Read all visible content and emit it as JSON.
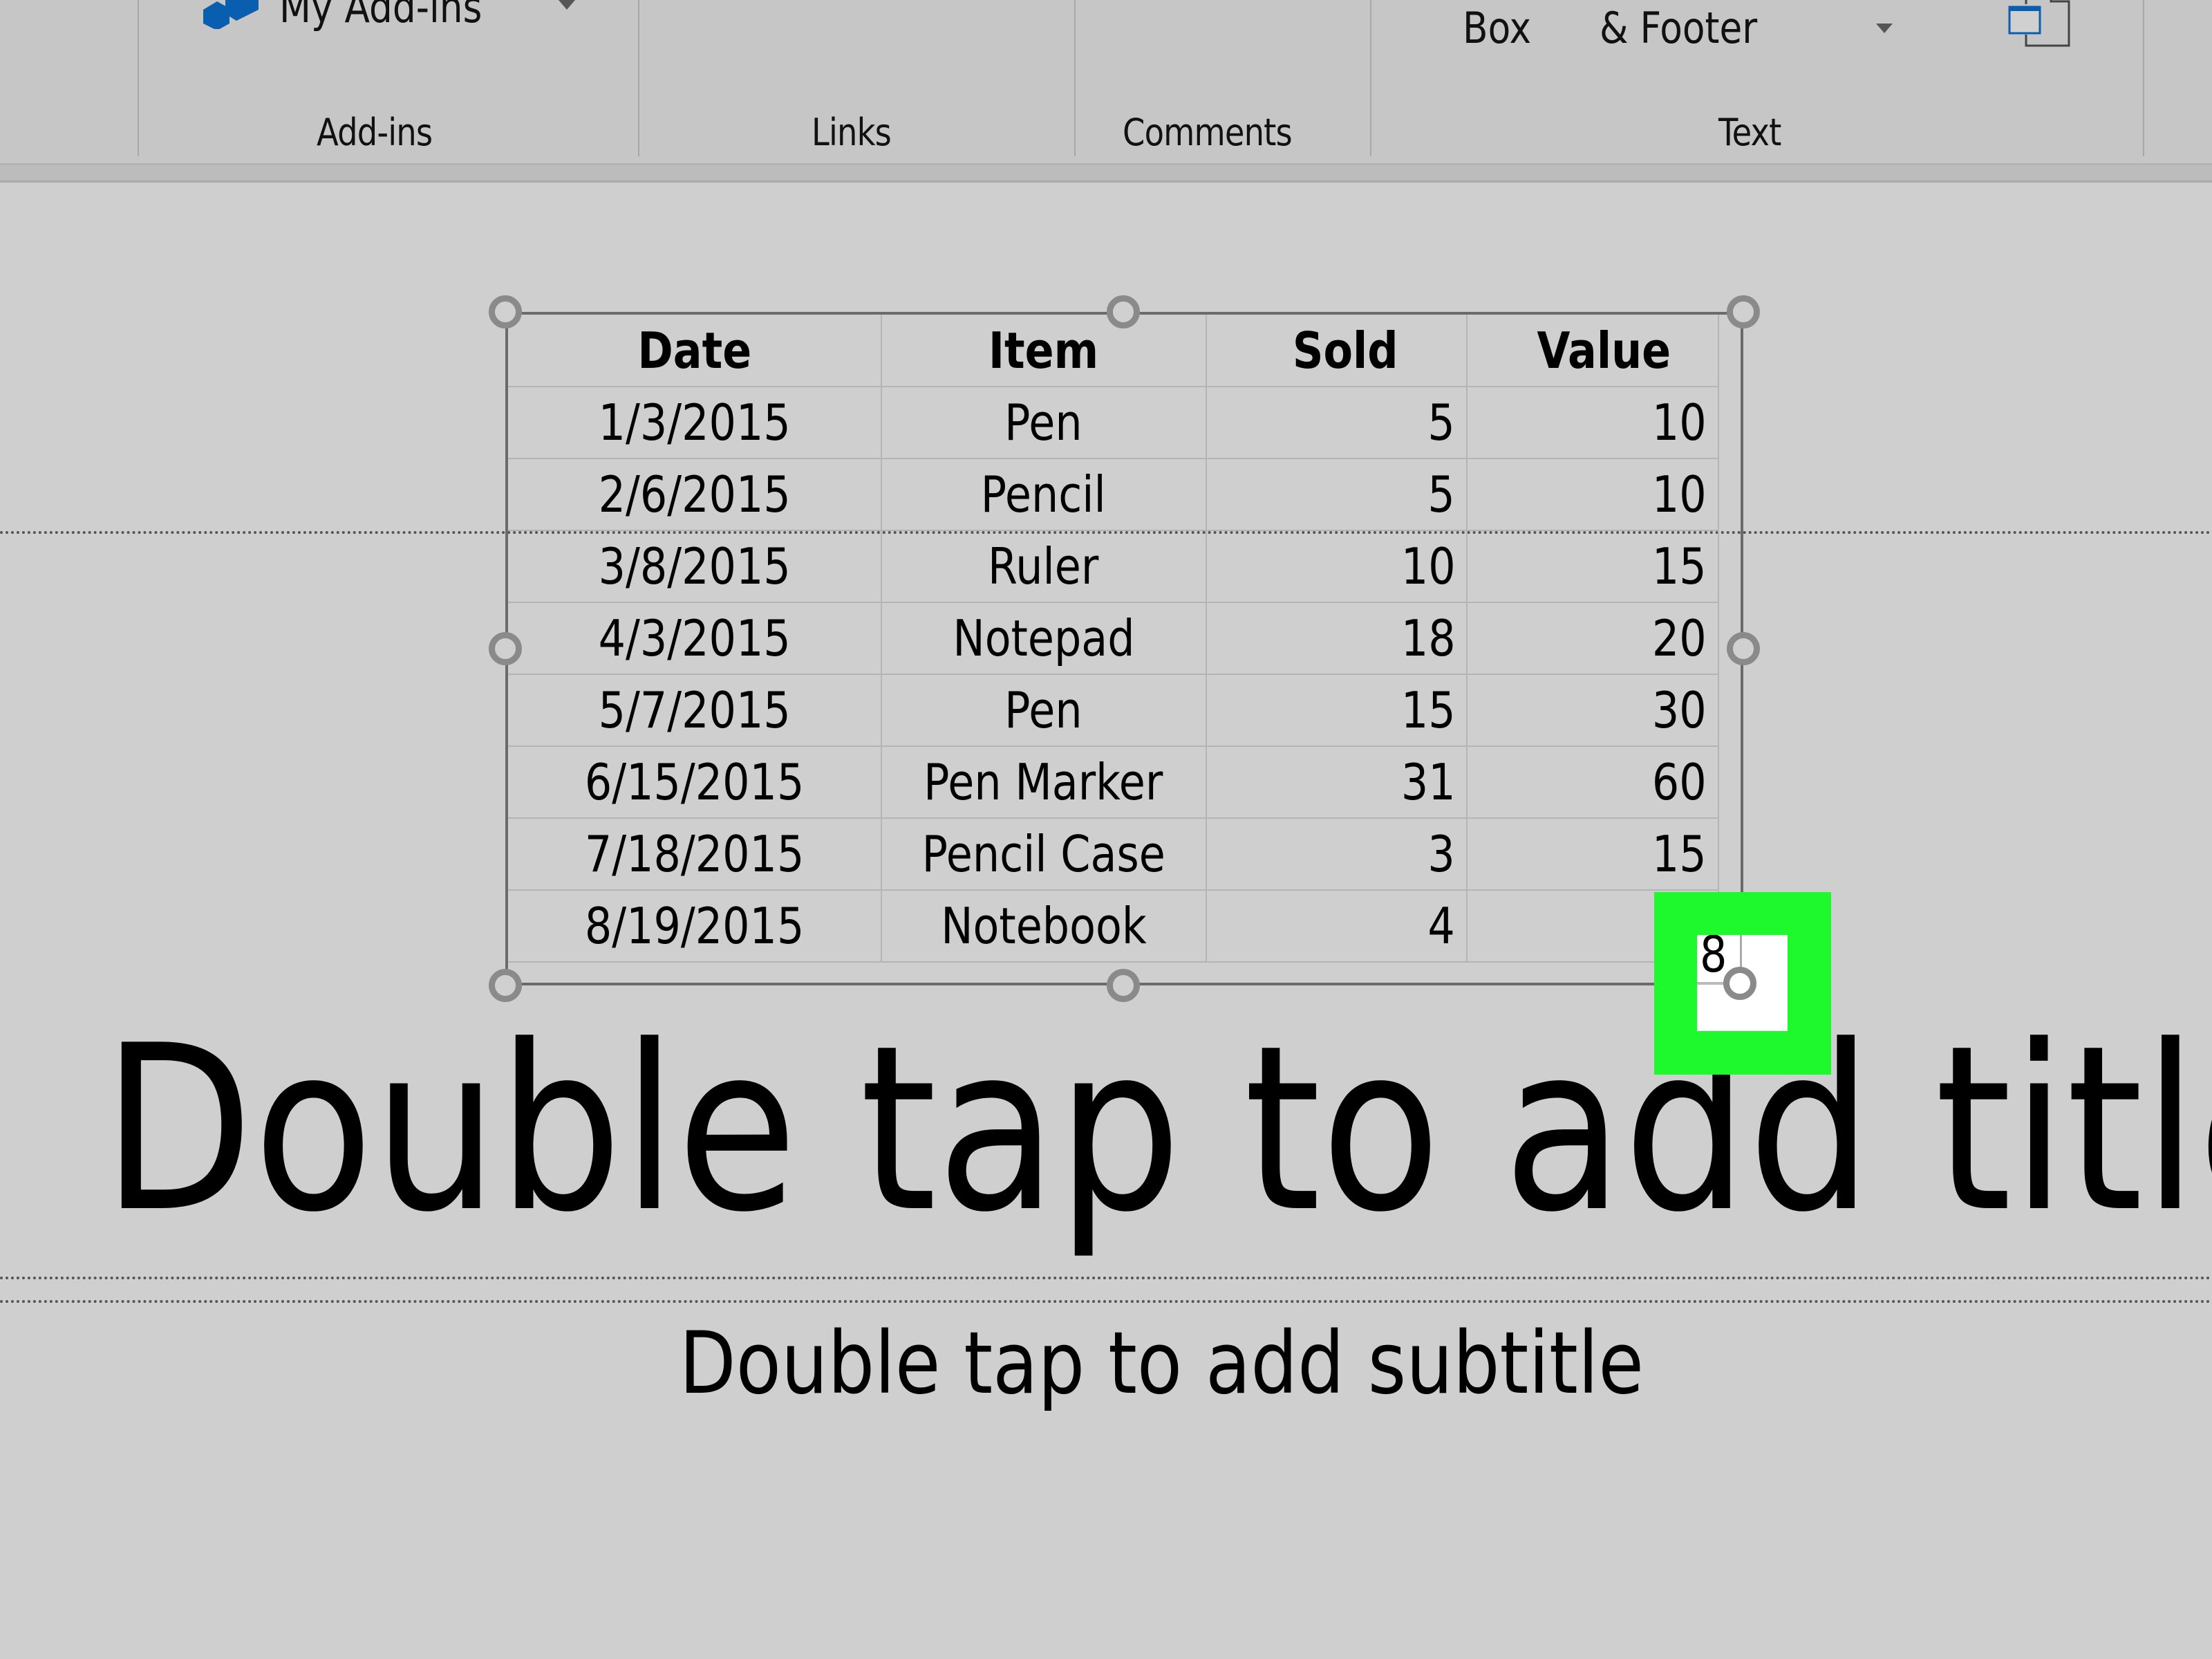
{
  "ribbon": {
    "addins_button_label": "My Add-ins",
    "text_box_label_fragment": "Box",
    "header_footer_label_fragment": "& Footer",
    "groups": [
      {
        "label": "Add-ins"
      },
      {
        "label": "Links"
      },
      {
        "label": "Comments"
      },
      {
        "label": "Text"
      }
    ],
    "icons": {
      "addins": "my-addins-icon",
      "object": "object-icon",
      "dropdown": "chevron-down-icon"
    },
    "accent_color": "#0a5eb0"
  },
  "slide": {
    "table": {
      "headers": [
        "Date",
        "Item",
        "Sold",
        "Value"
      ],
      "rows": [
        [
          "1/3/2015",
          "Pen",
          "5",
          "10"
        ],
        [
          "2/6/2015",
          "Pencil",
          "5",
          "10"
        ],
        [
          "3/8/2015",
          "Ruler",
          "10",
          "15"
        ],
        [
          "4/3/2015",
          "Notepad",
          "18",
          "20"
        ],
        [
          "5/7/2015",
          "Pen",
          "15",
          "30"
        ],
        [
          "6/15/2015",
          "Pen Marker",
          "31",
          "60"
        ],
        [
          "7/18/2015",
          "Pencil Case",
          "3",
          "15"
        ],
        [
          "8/19/2015",
          "Notebook",
          "4",
          "8"
        ]
      ]
    },
    "title_placeholder": "Double tap to add title",
    "subtitle_placeholder": "Double tap to add subtitle",
    "highlight_color": "#1ef92d"
  }
}
